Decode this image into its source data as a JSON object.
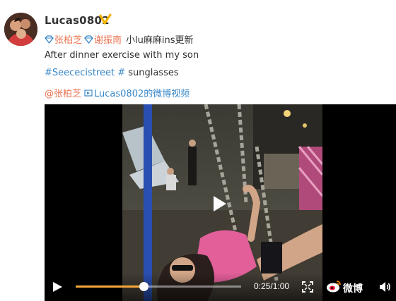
{
  "post": {
    "username": "Lucas0802",
    "mentions_row": {
      "mention1": "张柏芝",
      "mention2": "谢振南",
      "note": "小lu麻麻ins更新"
    },
    "text": "After dinner exercise with my son",
    "hashtag": "#Seececistreet #",
    "hashtag_suffix": " sunglasses",
    "footer": {
      "mention": "@张柏芝",
      "video_link": "Lucas0802的微博视频"
    }
  },
  "player": {
    "progress": 0.41,
    "time": "0:25/1:00",
    "brand": "微博"
  },
  "colors": {
    "accent_orange": "#eb7350",
    "link_blue": "#3a88c8",
    "progress": "#f4a63a",
    "verified": "#f7b500"
  }
}
